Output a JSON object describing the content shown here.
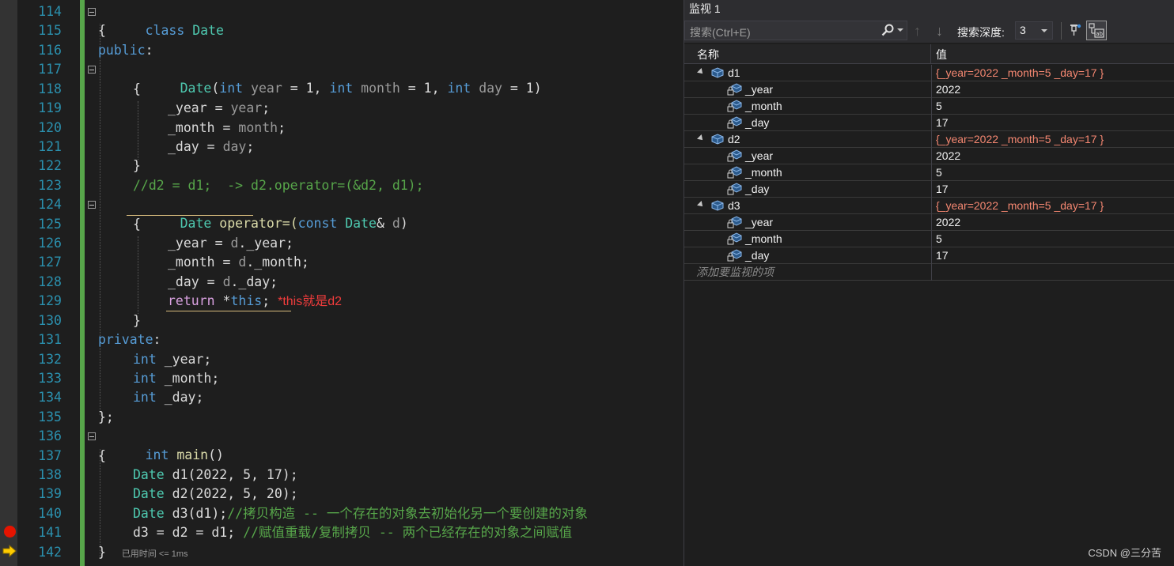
{
  "editor": {
    "lines": [
      {
        "num": "114"
      },
      {
        "num": "115"
      },
      {
        "num": "116"
      },
      {
        "num": "117"
      },
      {
        "num": "118"
      },
      {
        "num": "119"
      },
      {
        "num": "120"
      },
      {
        "num": "121"
      },
      {
        "num": "122"
      },
      {
        "num": "123"
      },
      {
        "num": "124"
      },
      {
        "num": "125"
      },
      {
        "num": "126"
      },
      {
        "num": "127"
      },
      {
        "num": "128"
      },
      {
        "num": "129"
      },
      {
        "num": "130"
      },
      {
        "num": "131"
      },
      {
        "num": "132"
      },
      {
        "num": "133"
      },
      {
        "num": "134"
      },
      {
        "num": "135"
      },
      {
        "num": "136"
      },
      {
        "num": "137"
      },
      {
        "num": "138"
      },
      {
        "num": "139"
      },
      {
        "num": "140"
      },
      {
        "num": "141"
      },
      {
        "num": "142"
      }
    ],
    "code": {
      "l114_kw": "class",
      "l114_ty": "Date",
      "l115": "{",
      "l116_kw": "public",
      "l116_p": ":",
      "l117_fn": "Date",
      "l117_a": "(",
      "l117_int1": "int",
      "l117_p1": "year",
      "l117_b": " = 1, ",
      "l117_int2": "int",
      "l117_p2": "month",
      "l117_c": " = 1, ",
      "l117_int3": "int",
      "l117_p3": "day",
      "l117_d": " = 1)",
      "l118": "{",
      "l119_f": "_year",
      "l119_a": " = ",
      "l119_p": "year",
      "l119_b": ";",
      "l120_f": "_month",
      "l120_a": " = ",
      "l120_p": "month",
      "l120_b": ";",
      "l121_f": "_day",
      "l121_a": " = ",
      "l121_p": "day",
      "l121_b": ";",
      "l122": "}",
      "l123": "//d2 = d1;  -> d2.operator=(&d2, d1);",
      "l124_ty": "Date",
      "l124_a": " operator=(",
      "l124_kw": "const",
      "l124_ty2": "Date",
      "l124_b": "& ",
      "l124_p": "d",
      "l124_c": ")",
      "l125": "{",
      "l126_f": "_year",
      "l126_a": " = ",
      "l126_p": "d",
      "l126_b": "._year;",
      "l127_f": "_month",
      "l127_a": " = ",
      "l127_p": "d",
      "l127_b": "._month;",
      "l128_f": "_day",
      "l128_a": " = ",
      "l128_p": "d",
      "l128_b": "._day;",
      "l129_ret": "return",
      "l129_a": " *",
      "l129_kw": "this",
      "l129_b": ";",
      "l129_annot": "*this就是d2",
      "l130": "}",
      "l131_kw": "private",
      "l131_p": ":",
      "l132_kw": "int",
      "l132_f": "_year;",
      "l133_kw": "int",
      "l133_f": "_month;",
      "l134_kw": "int",
      "l134_f": "_day;",
      "l135": "};",
      "l136_kw": "int",
      "l136_fn": "main",
      "l136_a": "()",
      "l137": "{",
      "l138_ty": "Date",
      "l138_a": " d1(2022, 5, 17);",
      "l139_ty": "Date",
      "l139_a": " d2(2022, 5, 20);",
      "l140_ty": "Date",
      "l140_a": " d3(d1);",
      "l140_cm": "//拷贝构造 -- 一个存在的对象去初始化另一个要创建的对象",
      "l141_a": "d3 = d2 = d1; ",
      "l141_cm": "//赋值重载/复制拷贝 -- 两个已经存在的对象之间赋值",
      "l142": "}",
      "l142_elapsed": "已用时间 <= 1ms"
    }
  },
  "watch": {
    "title": "监视 1",
    "search_placeholder": "搜索(Ctrl+E)",
    "depth_label": "搜索深度:",
    "depth_value": "3",
    "col_name": "名称",
    "col_value": "值",
    "rows": [
      {
        "name": "d1",
        "value": "{_year=2022 _month=5 _day=17 }"
      },
      {
        "name": "_year",
        "value": "2022"
      },
      {
        "name": "_month",
        "value": "5"
      },
      {
        "name": "_day",
        "value": "17"
      },
      {
        "name": "d2",
        "value": "{_year=2022 _month=5 _day=17 }"
      },
      {
        "name": "_year",
        "value": "2022"
      },
      {
        "name": "_month",
        "value": "5"
      },
      {
        "name": "_day",
        "value": "17"
      },
      {
        "name": "d3",
        "value": "{_year=2022 _month=5 _day=17 }"
      },
      {
        "name": "_year",
        "value": "2022"
      },
      {
        "name": "_month",
        "value": "5"
      },
      {
        "name": "_day",
        "value": "17"
      }
    ],
    "add_item": "添加要监视的项",
    "colors": {
      "changed_value": "#f48771",
      "accent": "#569cd6"
    }
  },
  "watermark": "CSDN @三分苦"
}
